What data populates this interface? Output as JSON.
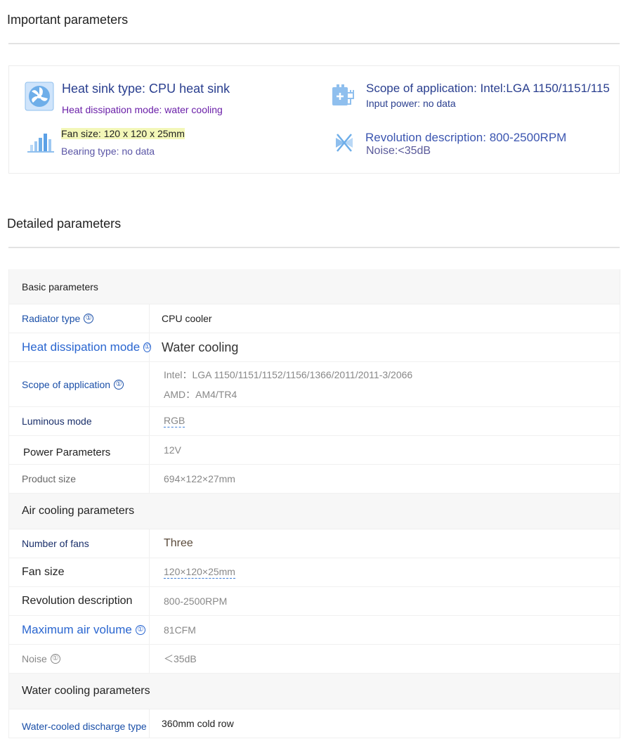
{
  "sections": {
    "important_title": "Important parameters",
    "detailed_title": "Detailed parameters"
  },
  "important": {
    "heat_sink_type": "Heat sink type: CPU heat sink",
    "heat_dissipation_mode": "Heat dissipation mode: water cooling",
    "fan_size": "Fan size: 120 x 120 x 25mm",
    "bearing_type": "Bearing type: no data",
    "scope": "Scope of application: Intel:LGA 1150/1151/115",
    "input_power": "Input power: no data",
    "revolution": "Revolution description: 800-2500RPM",
    "noise": "Noise:<35dB",
    "icons": [
      "fan-icon",
      "chart-icon",
      "power-icon",
      "cross-fan-icon"
    ]
  },
  "table": {
    "groups": {
      "basic": "Basic parameters",
      "air": "Air cooling parameters",
      "water": "Water cooling parameters"
    },
    "info_glyph": "①",
    "rows": {
      "radiator_type": {
        "label": "Radiator type",
        "value": "CPU cooler"
      },
      "heat_mode": {
        "label": "Heat dissipation mode",
        "value": "Water cooling"
      },
      "scope": {
        "label": "Scope of application",
        "value_line1": "Intel：LGA 1150/1151/1152/1156/1366/2011/2011-3/2066",
        "value_line2": "AMD：AM4/TR4"
      },
      "luminous": {
        "label": "Luminous mode",
        "value": "RGB"
      },
      "power": {
        "label": "Power Parameters",
        "value": "12V"
      },
      "product_size": {
        "label": "Product size",
        "value": "694×122×27mm"
      },
      "fan_count": {
        "label": "Number of fans",
        "value": "Three"
      },
      "fan_size": {
        "label": "Fan size",
        "value": "120×120×25mm"
      },
      "revolution": {
        "label": "Revolution description",
        "value": "800-2500RPM"
      },
      "max_air": {
        "label": "Maximum air volume",
        "value": "81CFM"
      },
      "noise": {
        "label": "Noise",
        "value": "＜35dB"
      },
      "discharge": {
        "label": "Water-cooled discharge type",
        "value": "360mm cold row"
      }
    }
  },
  "colors": {
    "label_blue": "#1a4fa8",
    "label_bright_blue": "#2a66d0",
    "purple": "#6a1fa8",
    "value_gray": "#888888",
    "icon_blue": "#5aa0e6",
    "highlight": "#f3f7b8"
  }
}
